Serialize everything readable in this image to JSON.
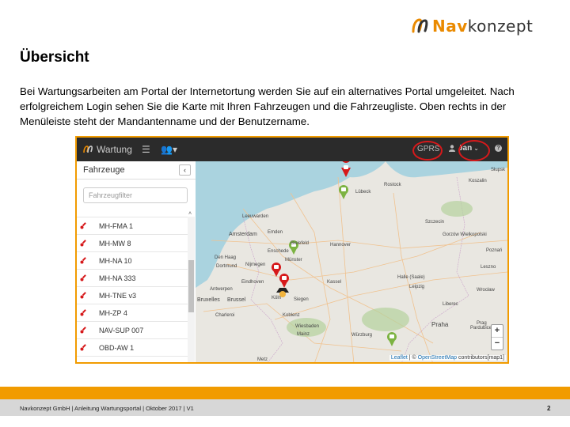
{
  "logo": {
    "part1": "Nav",
    "part2": "konzept",
    "accent": "#ea8a00"
  },
  "page": {
    "title": "Übersicht",
    "intro": "Bei Wartungsarbeiten am Portal der Internetortung werden Sie auf ein alternatives Portal umgeleitet. Nach erfolgreichem Login sehen Sie die Karte mit Ihren Fahrzeugen und die Fahrzeugliste. Oben rechts in der Menüleiste steht der Mandantenname und der Benutzername."
  },
  "screenshot": {
    "app_name": "Wartung",
    "list_icon": "list-icon",
    "group_icon": "users-dropdown-icon",
    "tenant": "GPRS",
    "user": "Jan",
    "highlight_color": "#d6191b",
    "frame_color": "#f19b00",
    "sidebar": {
      "title": "Fahrzeuge",
      "filter_placeholder": "Fahrzeugfilter",
      "vehicles": [
        "MH-FMA 1",
        "MH-MW 8",
        "MH-NA 10",
        "MH-NA 333",
        "MH-TNE v3",
        "MH-ZP 4",
        "NAV-SUP 007",
        "OBD-AW 1"
      ]
    },
    "map": {
      "attribution_leaflet": "Leaflet",
      "attribution_sep": " | © ",
      "attribution_osm": "OpenStreetMap",
      "attribution_rest": " contributors[map1]",
      "zoom_in": "+",
      "zoom_out": "−",
      "cities": [
        "Amsterdam",
        "Bruxelles",
        "Brussel",
        "Münster",
        "Hannover",
        "Kassel",
        "Halle (Saale)",
        "Leipzig",
        "Prag",
        "Praha",
        "Würzburg",
        "Mainz",
        "Rostock",
        "Lübeck",
        "Szczecin",
        "Koszalin",
        "Słupsk",
        "Gorzów Wielkopolski",
        "Poznań",
        "Leszno",
        "Wrocław",
        "Pardubice",
        "Liberec",
        "Koblenz",
        "Wiesbaden",
        "Köln",
        "Siegen",
        "Emden",
        "Enschede",
        "Eindhoven",
        "Antwerpen",
        "Charleroi",
        "Den Haag",
        "Dortmund",
        "Nijmegen",
        "Bielefeld",
        "Leeuwarden",
        "Metz"
      ]
    }
  },
  "footer": {
    "text": "Navkonzept GmbH | Anleitung Wartungsportal | Oktober 2017 | V1",
    "page": "2"
  }
}
